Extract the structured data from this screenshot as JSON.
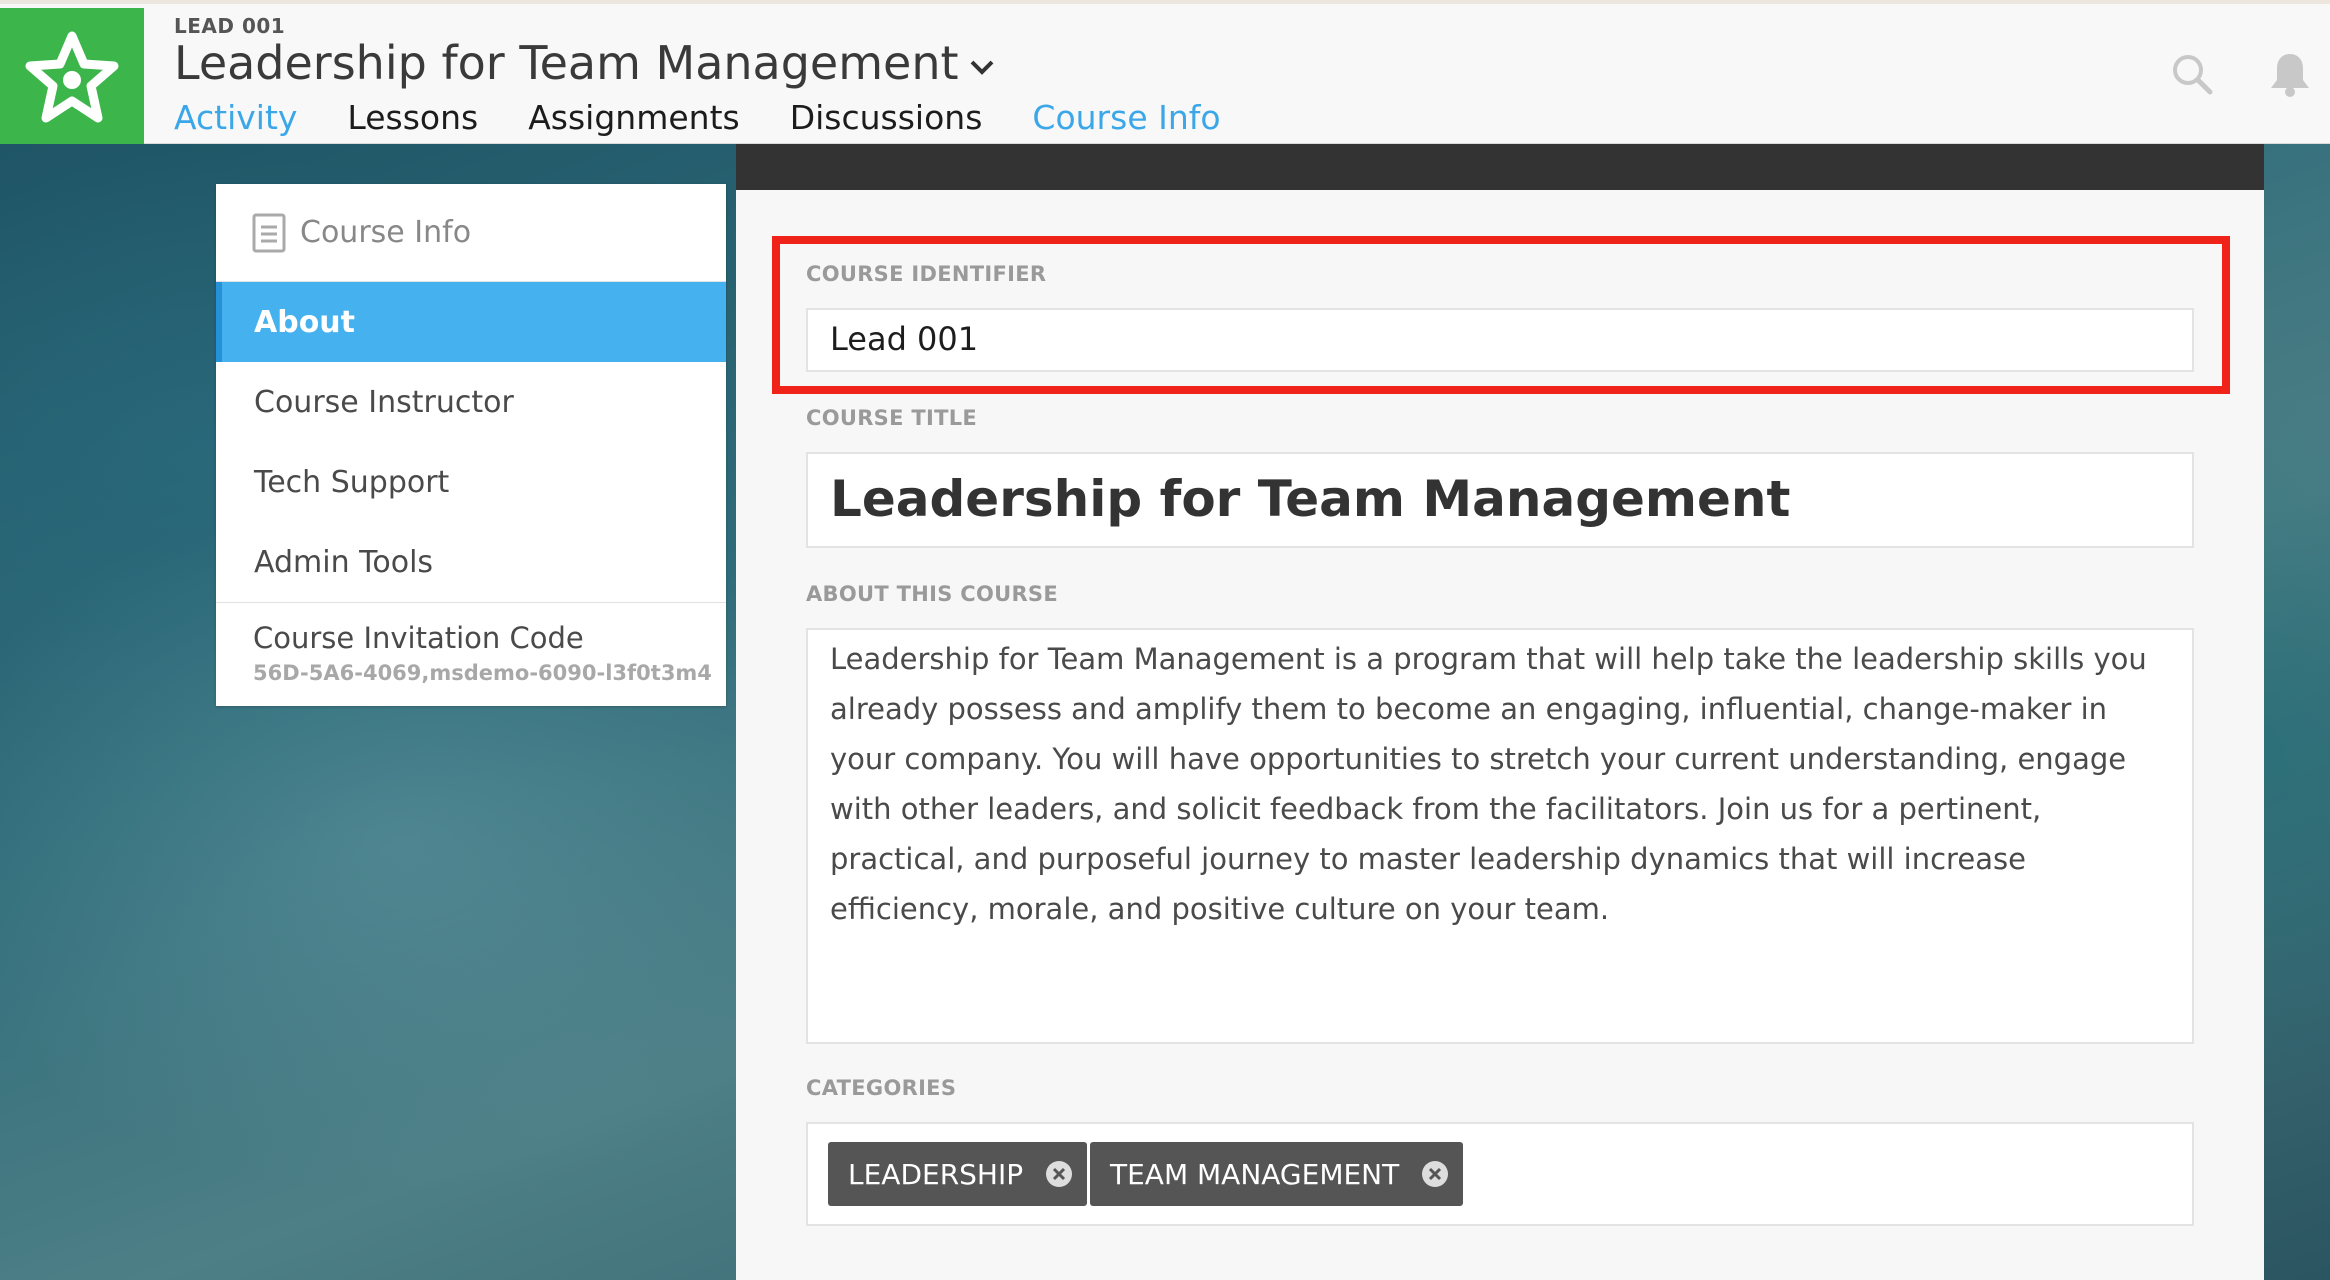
{
  "header": {
    "course_code": "LEAD 001",
    "course_title": "Leadership for Team Management",
    "tabs": [
      {
        "label": "Activity"
      },
      {
        "label": "Lessons"
      },
      {
        "label": "Assignments"
      },
      {
        "label": "Discussions"
      },
      {
        "label": "Course Info"
      }
    ],
    "active_tab": "Course Info",
    "icons": [
      "search-icon",
      "bell-icon"
    ]
  },
  "sidebar": {
    "heading": "Course Info",
    "items": [
      {
        "label": "About"
      },
      {
        "label": "Course Instructor"
      },
      {
        "label": "Tech Support"
      },
      {
        "label": "Admin Tools"
      }
    ],
    "active_item": "About",
    "invitation_code_label": "Course Invitation Code",
    "invitation_code_value": "56D-5A6-4069,msdemo-6090-l3f0t3m4"
  },
  "form": {
    "identifier_label": "COURSE IDENTIFIER",
    "identifier_value": "Lead 001",
    "title_label": "COURSE TITLE",
    "title_value": "Leadership for Team Management",
    "about_label": "ABOUT THIS COURSE",
    "about_value": "Leadership for Team Management is a program that will help take the leadership skills you already possess and amplify them to become an engaging, influential, change-maker in your company. You will have opportunities to stretch your current understanding, engage with other leaders, and solicit feedback from the facilitators. Join us for a pertinent, practical, and purposeful journey to master leadership dynamics that will increase efficiency, morale, and positive culture on your team.",
    "categories_label": "CATEGORIES",
    "categories": [
      {
        "label": "LEADERSHIP"
      },
      {
        "label": "TEAM MANAGEMENT"
      }
    ]
  },
  "colors": {
    "brand_green": "#3cb54a",
    "accent_blue": "#3ba7e8",
    "highlight_red": "#f0231b",
    "chip_gray": "#555555"
  }
}
